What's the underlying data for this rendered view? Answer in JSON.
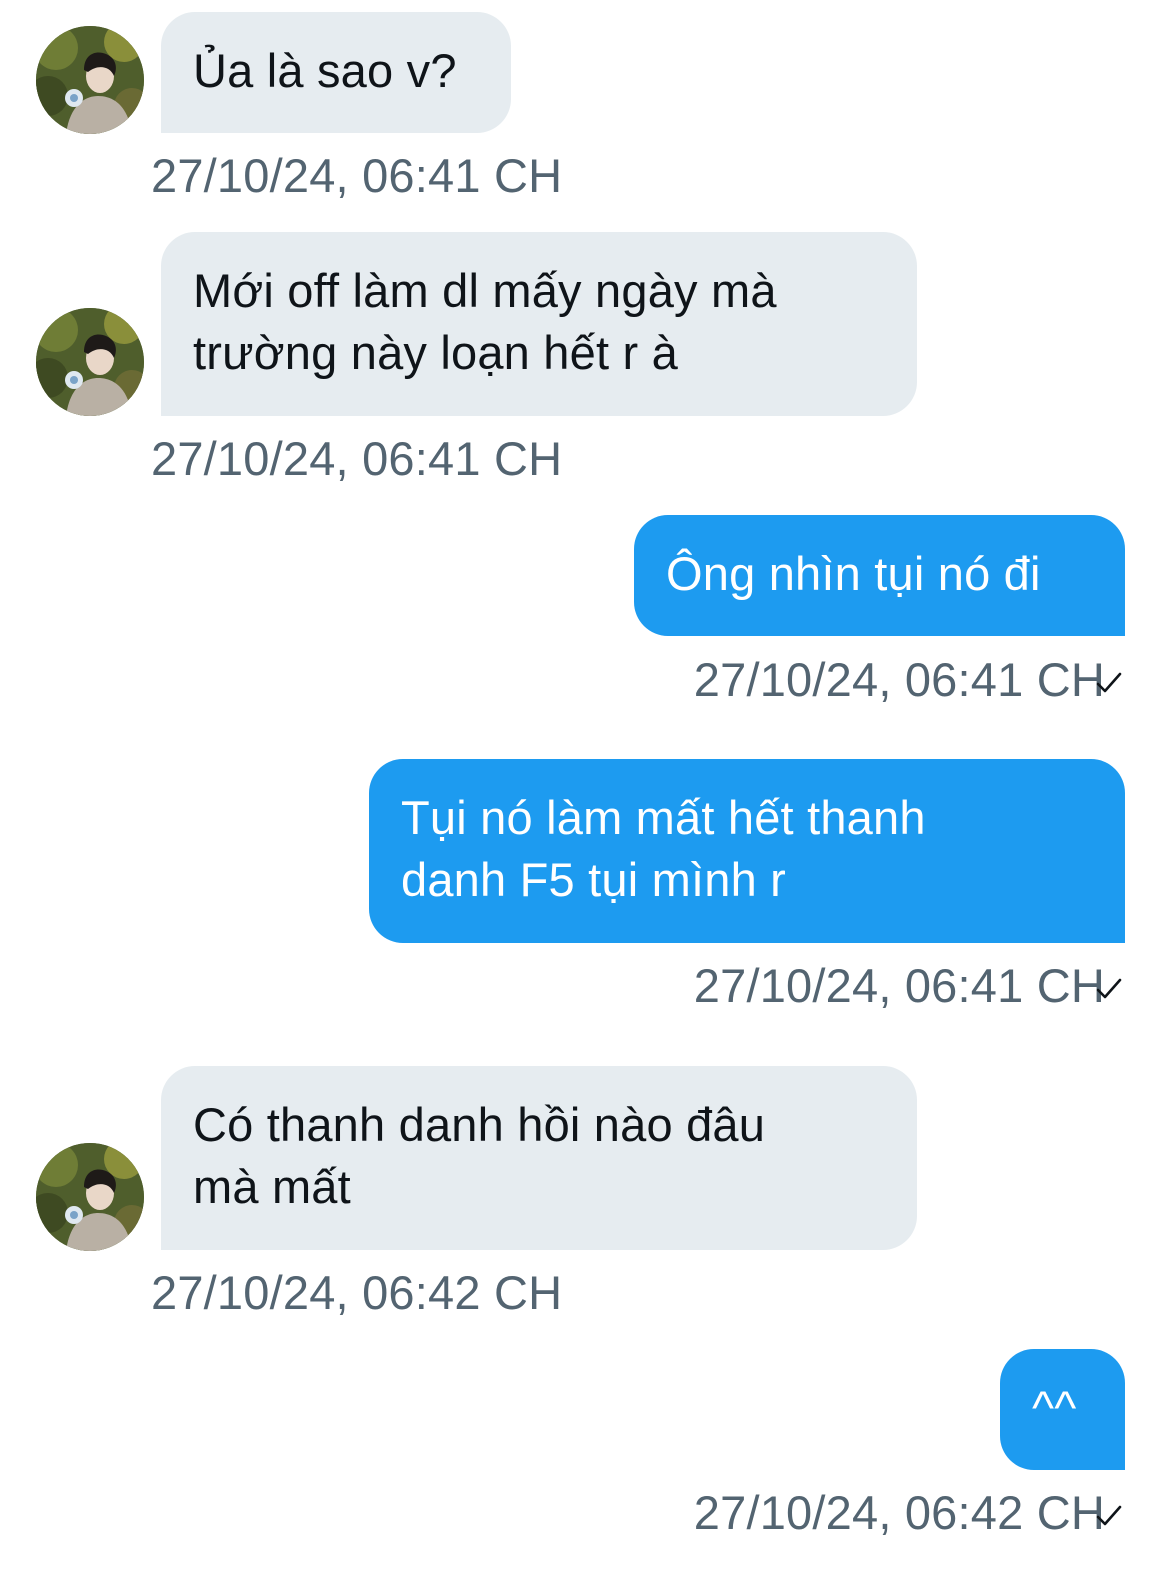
{
  "colors": {
    "incoming_bubble": "#e6ecf0",
    "outgoing_bubble": "#1d9bf0",
    "timestamp": "#536471",
    "incoming_text": "#0f1419",
    "outgoing_text": "#ffffff"
  },
  "messages": [
    {
      "direction": "incoming",
      "lines": [
        "Ủa là sao v?"
      ],
      "timestamp": "27/10/24, 06:41 CH"
    },
    {
      "direction": "incoming",
      "lines": [
        "Mới off làm dl mấy ngày mà",
        "trường này loạn hết r à"
      ],
      "timestamp": "27/10/24, 06:41 CH"
    },
    {
      "direction": "outgoing",
      "lines": [
        "Ông nhìn tụi nó đi"
      ],
      "timestamp": "27/10/24, 06:41 CH",
      "status_icon": "checkmark-icon"
    },
    {
      "direction": "outgoing",
      "lines": [
        "Tụi nó làm mất hết thanh",
        "danh F5 tụi mình r"
      ],
      "timestamp": "27/10/24, 06:41 CH",
      "status_icon": "checkmark-icon"
    },
    {
      "direction": "incoming",
      "lines": [
        "Có thanh danh hồi nào đâu",
        "mà mất"
      ],
      "timestamp": "27/10/24, 06:42 CH"
    },
    {
      "direction": "outgoing",
      "lines": [
        "^^"
      ],
      "timestamp": "27/10/24, 06:42 CH",
      "status_icon": "checkmark-icon"
    }
  ]
}
